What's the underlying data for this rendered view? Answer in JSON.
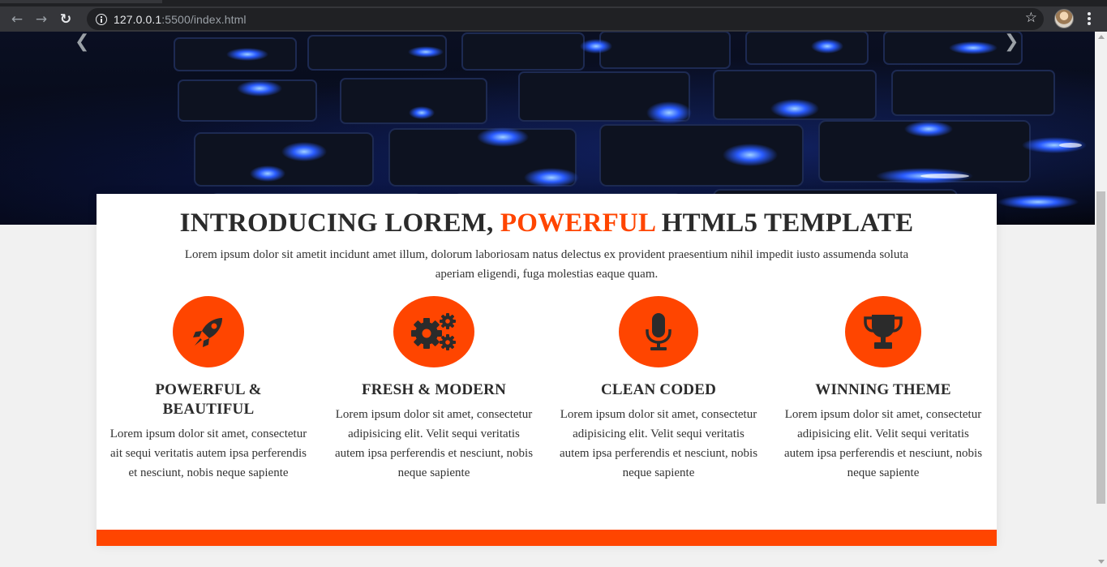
{
  "browser": {
    "url_host": "127.0.0.1",
    "url_rest": ":5500/index.html"
  },
  "hero": {
    "prev_icon": "chevron-left-icon",
    "next_icon": "chevron-right-icon"
  },
  "intro": {
    "headline_pre": "INTRODUCING LOREM, ",
    "headline_accent": "POWERFUL",
    "headline_post": " HTML5 TEMPLATE",
    "text": "Lorem ipsum dolor sit ametit incidunt amet illum, dolorum laboriosam natus delectus ex provident praesentium nihil impedit iusto assumenda soluta aperiam eligendi, fuga molestias eaque quam."
  },
  "features": [
    {
      "icon": "rocket-icon",
      "title": "POWERFUL & BEAUTIFUL",
      "desc": "Lorem ipsum dolor sit amet, consectetur ait sequi veritatis autem ipsa perferendis et nesciunt, nobis neque sapiente"
    },
    {
      "icon": "gears-icon",
      "title": "FRESH & MODERN",
      "desc": "Lorem ipsum dolor sit amet, consectetur adipisicing elit. Velit sequi veritatis autem ipsa perferendis et nesciunt, nobis neque sapiente"
    },
    {
      "icon": "microphone-icon",
      "title": "CLEAN CODED",
      "desc": "Lorem ipsum dolor sit amet, consectetur adipisicing elit. Velit sequi veritatis autem ipsa perferendis et nesciunt, nobis neque sapiente"
    },
    {
      "icon": "trophy-icon",
      "title": "WINNING THEME",
      "desc": "Lorem ipsum dolor sit amet, consectetur adipisicing elit. Velit sequi veritatis autem ipsa perferendis et nesciunt, nobis neque sapiente"
    }
  ],
  "colors": {
    "accent": "#ff4500",
    "text": "#2b2b2b",
    "chrome": "#35363a"
  }
}
